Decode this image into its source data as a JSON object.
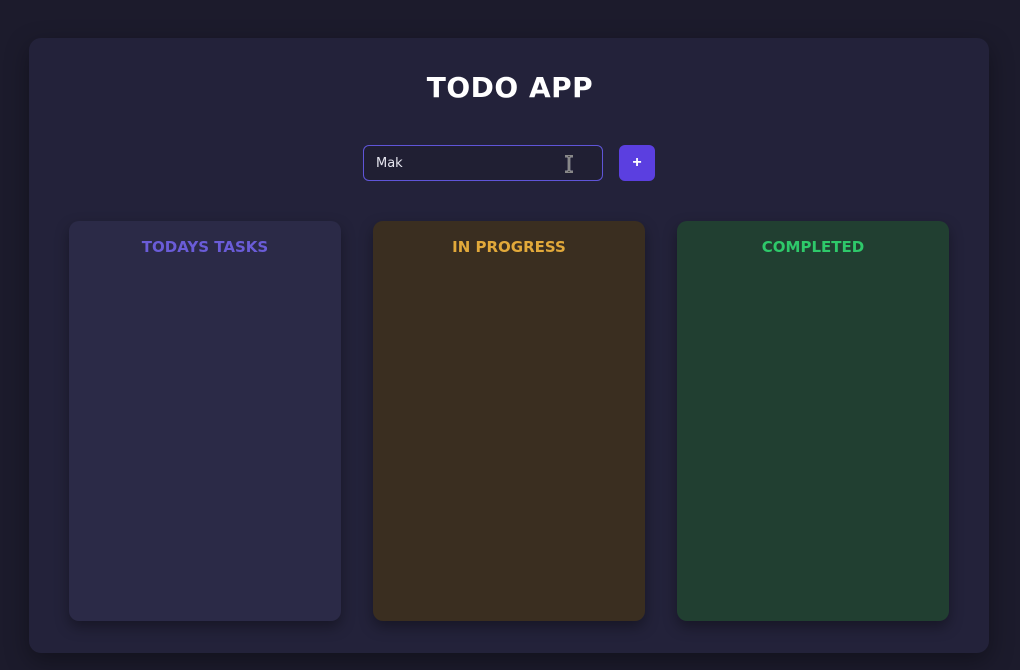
{
  "app": {
    "title": "TODO APP"
  },
  "task_form": {
    "input_value": "Mak",
    "add_button_label": "+"
  },
  "columns": [
    {
      "title": "TODAYS TASKS",
      "color": "#6a5cd8"
    },
    {
      "title": "IN PROGRESS",
      "color": "#e2a93a"
    },
    {
      "title": "COMPLETED",
      "color": "#2ec96a"
    }
  ]
}
